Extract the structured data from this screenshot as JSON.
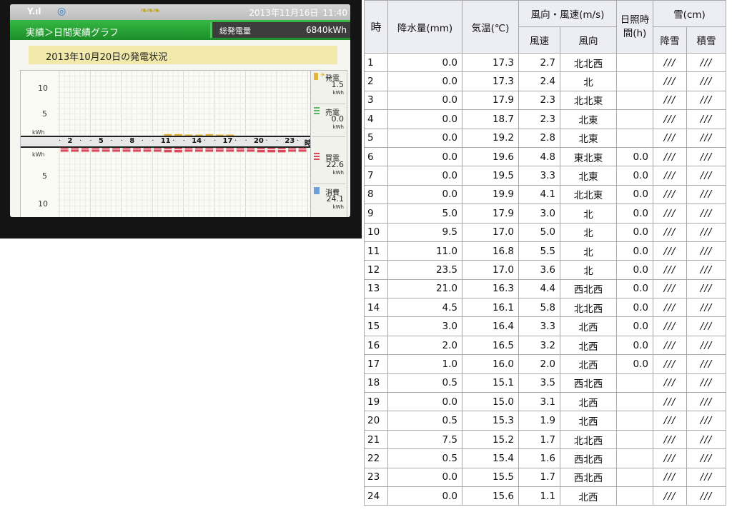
{
  "device": {
    "status": {
      "date": "2013年11月16日",
      "time": "11:40"
    },
    "nav": {
      "breadcrumb": "実績＞日間実績グラフ",
      "total_label": "総発電量",
      "total_value": "6840kWh"
    },
    "day_title": "2013年10月20日の発電状況",
    "chart": {
      "upper_y_labels": [
        "10",
        "5"
      ],
      "lower_y_labels": [
        "5",
        "10"
      ],
      "unit": "kWh",
      "hour_ticks": [
        "2",
        "5",
        "8",
        "11",
        "14",
        "17",
        "20",
        "23"
      ],
      "hour_suffix": "時",
      "upper_ylim": [
        0,
        12
      ],
      "lower_ylim": [
        0,
        12
      ],
      "generation_hourly": [
        0,
        0,
        0,
        0,
        0,
        0,
        0,
        0,
        0,
        0,
        0.3,
        0.3,
        0.2,
        0.2,
        0.3,
        0.2,
        0.2,
        0,
        0,
        0,
        0,
        0,
        0,
        0
      ],
      "purchase_hourly": [
        0.9,
        0.9,
        0.9,
        0.9,
        0.9,
        0.9,
        0.9,
        0.9,
        0.9,
        0.9,
        1.0,
        1.0,
        0.9,
        0.9,
        0.9,
        0.9,
        0.9,
        0.9,
        0.9,
        1.0,
        1.0,
        1.0,
        0.9,
        0.9
      ],
      "colors": {
        "generation": "#e0b040",
        "purchase": "#d9475a",
        "consumption": "#6f9fd8",
        "sell": "#58b860"
      }
    },
    "side": {
      "generation": {
        "label": "発電",
        "value": "1.5",
        "unit": "kWh"
      },
      "sell": {
        "label": "売電",
        "value": "0.0",
        "unit": "kWh"
      },
      "purchase": {
        "label": "買電",
        "value": "22.6",
        "unit": "kWh"
      },
      "consumption": {
        "label": "消費",
        "value": "24.1",
        "unit": "kWh"
      }
    }
  },
  "table": {
    "headers": {
      "hour": "時",
      "precip": "降水量(mm)",
      "temp": "気温(℃)",
      "wind_group": "風向・風速(m/s)",
      "wind_speed": "風速",
      "wind_dir": "風向",
      "sunshine": "日照時間(h)",
      "snow_group": "雪(cm)",
      "snowfall": "降雪",
      "snow_depth": "積雪"
    },
    "rows": [
      {
        "h": "1",
        "p": "0.0",
        "t": "17.3",
        "ws": "2.7",
        "wd": "北北西",
        "s": "",
        "sf": "///",
        "sd": "///"
      },
      {
        "h": "2",
        "p": "0.0",
        "t": "17.3",
        "ws": "2.4",
        "wd": "北",
        "s": "",
        "sf": "///",
        "sd": "///"
      },
      {
        "h": "3",
        "p": "0.0",
        "t": "17.9",
        "ws": "2.3",
        "wd": "北北東",
        "s": "",
        "sf": "///",
        "sd": "///"
      },
      {
        "h": "4",
        "p": "0.0",
        "t": "18.7",
        "ws": "2.3",
        "wd": "北東",
        "s": "",
        "sf": "///",
        "sd": "///"
      },
      {
        "h": "5",
        "p": "0.0",
        "t": "19.2",
        "ws": "2.8",
        "wd": "北東",
        "s": "",
        "sf": "///",
        "sd": "///"
      },
      {
        "h": "6",
        "p": "0.0",
        "t": "19.6",
        "ws": "4.8",
        "wd": "東北東",
        "s": "0.0",
        "sf": "///",
        "sd": "///"
      },
      {
        "h": "7",
        "p": "0.0",
        "t": "19.5",
        "ws": "3.3",
        "wd": "北東",
        "s": "0.0",
        "sf": "///",
        "sd": "///"
      },
      {
        "h": "8",
        "p": "0.0",
        "t": "19.9",
        "ws": "4.1",
        "wd": "北北東",
        "s": "0.0",
        "sf": "///",
        "sd": "///"
      },
      {
        "h": "9",
        "p": "5.0",
        "t": "17.9",
        "ws": "3.0",
        "wd": "北",
        "s": "0.0",
        "sf": "///",
        "sd": "///"
      },
      {
        "h": "10",
        "p": "9.5",
        "t": "17.0",
        "ws": "5.0",
        "wd": "北",
        "s": "0.0",
        "sf": "///",
        "sd": "///"
      },
      {
        "h": "11",
        "p": "11.0",
        "t": "16.8",
        "ws": "5.5",
        "wd": "北",
        "s": "0.0",
        "sf": "///",
        "sd": "///"
      },
      {
        "h": "12",
        "p": "23.5",
        "t": "17.0",
        "ws": "3.6",
        "wd": "北",
        "s": "0.0",
        "sf": "///",
        "sd": "///"
      },
      {
        "h": "13",
        "p": "21.0",
        "t": "16.3",
        "ws": "4.4",
        "wd": "西北西",
        "s": "0.0",
        "sf": "///",
        "sd": "///"
      },
      {
        "h": "14",
        "p": "4.5",
        "t": "16.1",
        "ws": "5.8",
        "wd": "北北西",
        "s": "0.0",
        "sf": "///",
        "sd": "///"
      },
      {
        "h": "15",
        "p": "3.0",
        "t": "16.4",
        "ws": "3.3",
        "wd": "北西",
        "s": "0.0",
        "sf": "///",
        "sd": "///"
      },
      {
        "h": "16",
        "p": "2.0",
        "t": "16.5",
        "ws": "3.2",
        "wd": "北西",
        "s": "0.0",
        "sf": "///",
        "sd": "///"
      },
      {
        "h": "17",
        "p": "1.0",
        "t": "16.0",
        "ws": "2.0",
        "wd": "北西",
        "s": "0.0",
        "sf": "///",
        "sd": "///"
      },
      {
        "h": "18",
        "p": "0.5",
        "t": "15.1",
        "ws": "3.5",
        "wd": "西北西",
        "s": "",
        "sf": "///",
        "sd": "///"
      },
      {
        "h": "19",
        "p": "0.0",
        "t": "15.0",
        "ws": "3.1",
        "wd": "北西",
        "s": "",
        "sf": "///",
        "sd": "///"
      },
      {
        "h": "20",
        "p": "0.5",
        "t": "15.3",
        "ws": "1.9",
        "wd": "北西",
        "s": "",
        "sf": "///",
        "sd": "///"
      },
      {
        "h": "21",
        "p": "7.5",
        "t": "15.2",
        "ws": "1.7",
        "wd": "北北西",
        "s": "",
        "sf": "///",
        "sd": "///"
      },
      {
        "h": "22",
        "p": "0.5",
        "t": "15.4",
        "ws": "1.6",
        "wd": "西北西",
        "s": "",
        "sf": "///",
        "sd": "///"
      },
      {
        "h": "23",
        "p": "0.0",
        "t": "15.5",
        "ws": "1.7",
        "wd": "西北西",
        "s": "",
        "sf": "///",
        "sd": "///"
      },
      {
        "h": "24",
        "p": "0.0",
        "t": "15.6",
        "ws": "1.1",
        "wd": "北西",
        "s": "",
        "sf": "///",
        "sd": "///"
      }
    ]
  }
}
